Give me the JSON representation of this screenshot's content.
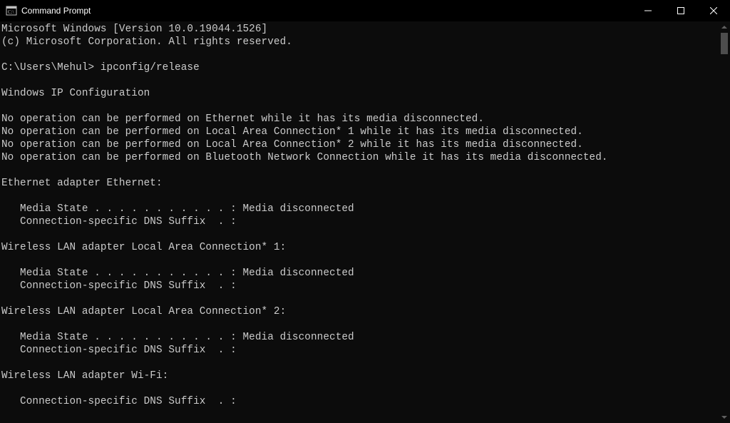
{
  "window": {
    "title": "Command Prompt"
  },
  "terminal": {
    "line0": "Microsoft Windows [Version 10.0.19044.1526]",
    "line1": "(c) Microsoft Corporation. All rights reserved.",
    "line2": "",
    "line3_prompt": "C:\\Users\\Mehul>",
    "line3_cmd": " ipconfig/release",
    "line4": "",
    "line5": "Windows IP Configuration",
    "line6": "",
    "line7": "No operation can be performed on Ethernet while it has its media disconnected.",
    "line8": "No operation can be performed on Local Area Connection* 1 while it has its media disconnected.",
    "line9": "No operation can be performed on Local Area Connection* 2 while it has its media disconnected.",
    "line10": "No operation can be performed on Bluetooth Network Connection while it has its media disconnected.",
    "line11": "",
    "line12": "Ethernet adapter Ethernet:",
    "line13": "",
    "line14": "   Media State . . . . . . . . . . . : Media disconnected",
    "line15": "   Connection-specific DNS Suffix  . :",
    "line16": "",
    "line17": "Wireless LAN adapter Local Area Connection* 1:",
    "line18": "",
    "line19": "   Media State . . . . . . . . . . . : Media disconnected",
    "line20": "   Connection-specific DNS Suffix  . :",
    "line21": "",
    "line22": "Wireless LAN adapter Local Area Connection* 2:",
    "line23": "",
    "line24": "   Media State . . . . . . . . . . . : Media disconnected",
    "line25": "   Connection-specific DNS Suffix  . :",
    "line26": "",
    "line27": "Wireless LAN adapter Wi-Fi:",
    "line28": "",
    "line29": "   Connection-specific DNS Suffix  . :"
  }
}
